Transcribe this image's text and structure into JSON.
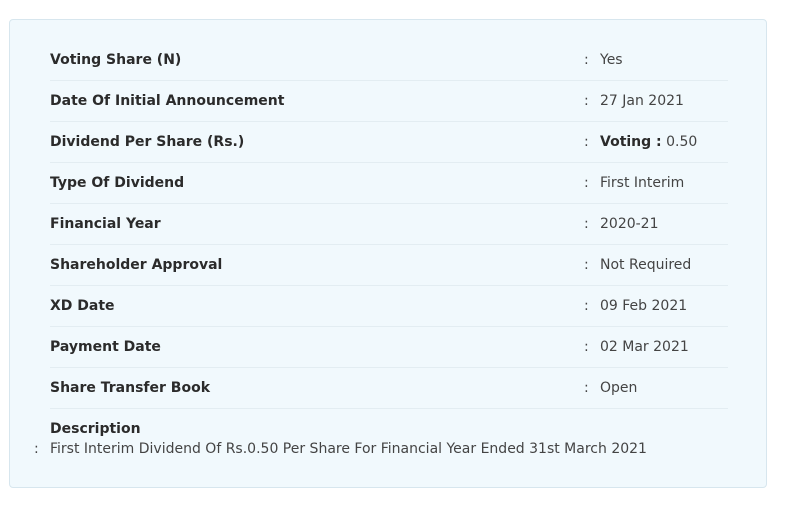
{
  "details": {
    "voting_share": {
      "label": "Voting Share (N)",
      "separator": ":",
      "value": "Yes"
    },
    "initial_announcement": {
      "label": "Date Of Initial Announcement",
      "separator": ":",
      "value": "27 Jan 2021"
    },
    "dividend_per_share": {
      "label": "Dividend Per Share (Rs.)",
      "separator": ":",
      "value_prefix": "Voting :",
      "value": "0.50"
    },
    "dividend_type": {
      "label": "Type Of Dividend",
      "separator": ":",
      "value": "First Interim"
    },
    "financial_year": {
      "label": "Financial Year",
      "separator": ":",
      "value": "2020-21"
    },
    "shareholder_approval": {
      "label": "Shareholder Approval",
      "separator": ":",
      "value": "Not Required"
    },
    "xd_date": {
      "label": "XD Date",
      "separator": ":",
      "value": "09 Feb 2021"
    },
    "payment_date": {
      "label": "Payment Date",
      "separator": ":",
      "value": "02 Mar 2021"
    },
    "share_transfer_book": {
      "label": "Share Transfer Book",
      "separator": ":",
      "value": "Open"
    },
    "description": {
      "label": "Description",
      "separator": ":",
      "value": "First Interim Dividend Of Rs.0.50 Per Share For Financial Year Ended 31st March 2021"
    }
  }
}
